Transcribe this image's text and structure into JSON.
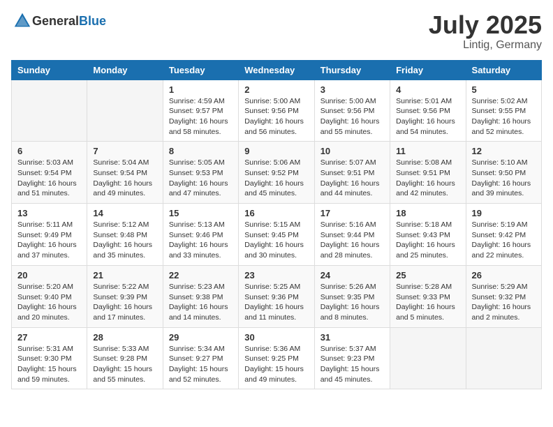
{
  "header": {
    "logo_general": "General",
    "logo_blue": "Blue",
    "month": "July 2025",
    "location": "Lintig, Germany"
  },
  "weekdays": [
    "Sunday",
    "Monday",
    "Tuesday",
    "Wednesday",
    "Thursday",
    "Friday",
    "Saturday"
  ],
  "weeks": [
    [
      {
        "day": "",
        "sunrise": "",
        "sunset": "",
        "daylight": ""
      },
      {
        "day": "",
        "sunrise": "",
        "sunset": "",
        "daylight": ""
      },
      {
        "day": "1",
        "sunrise": "Sunrise: 4:59 AM",
        "sunset": "Sunset: 9:57 PM",
        "daylight": "Daylight: 16 hours and 58 minutes."
      },
      {
        "day": "2",
        "sunrise": "Sunrise: 5:00 AM",
        "sunset": "Sunset: 9:56 PM",
        "daylight": "Daylight: 16 hours and 56 minutes."
      },
      {
        "day": "3",
        "sunrise": "Sunrise: 5:00 AM",
        "sunset": "Sunset: 9:56 PM",
        "daylight": "Daylight: 16 hours and 55 minutes."
      },
      {
        "day": "4",
        "sunrise": "Sunrise: 5:01 AM",
        "sunset": "Sunset: 9:56 PM",
        "daylight": "Daylight: 16 hours and 54 minutes."
      },
      {
        "day": "5",
        "sunrise": "Sunrise: 5:02 AM",
        "sunset": "Sunset: 9:55 PM",
        "daylight": "Daylight: 16 hours and 52 minutes."
      }
    ],
    [
      {
        "day": "6",
        "sunrise": "Sunrise: 5:03 AM",
        "sunset": "Sunset: 9:54 PM",
        "daylight": "Daylight: 16 hours and 51 minutes."
      },
      {
        "day": "7",
        "sunrise": "Sunrise: 5:04 AM",
        "sunset": "Sunset: 9:54 PM",
        "daylight": "Daylight: 16 hours and 49 minutes."
      },
      {
        "day": "8",
        "sunrise": "Sunrise: 5:05 AM",
        "sunset": "Sunset: 9:53 PM",
        "daylight": "Daylight: 16 hours and 47 minutes."
      },
      {
        "day": "9",
        "sunrise": "Sunrise: 5:06 AM",
        "sunset": "Sunset: 9:52 PM",
        "daylight": "Daylight: 16 hours and 45 minutes."
      },
      {
        "day": "10",
        "sunrise": "Sunrise: 5:07 AM",
        "sunset": "Sunset: 9:51 PM",
        "daylight": "Daylight: 16 hours and 44 minutes."
      },
      {
        "day": "11",
        "sunrise": "Sunrise: 5:08 AM",
        "sunset": "Sunset: 9:51 PM",
        "daylight": "Daylight: 16 hours and 42 minutes."
      },
      {
        "day": "12",
        "sunrise": "Sunrise: 5:10 AM",
        "sunset": "Sunset: 9:50 PM",
        "daylight": "Daylight: 16 hours and 39 minutes."
      }
    ],
    [
      {
        "day": "13",
        "sunrise": "Sunrise: 5:11 AM",
        "sunset": "Sunset: 9:49 PM",
        "daylight": "Daylight: 16 hours and 37 minutes."
      },
      {
        "day": "14",
        "sunrise": "Sunrise: 5:12 AM",
        "sunset": "Sunset: 9:48 PM",
        "daylight": "Daylight: 16 hours and 35 minutes."
      },
      {
        "day": "15",
        "sunrise": "Sunrise: 5:13 AM",
        "sunset": "Sunset: 9:46 PM",
        "daylight": "Daylight: 16 hours and 33 minutes."
      },
      {
        "day": "16",
        "sunrise": "Sunrise: 5:15 AM",
        "sunset": "Sunset: 9:45 PM",
        "daylight": "Daylight: 16 hours and 30 minutes."
      },
      {
        "day": "17",
        "sunrise": "Sunrise: 5:16 AM",
        "sunset": "Sunset: 9:44 PM",
        "daylight": "Daylight: 16 hours and 28 minutes."
      },
      {
        "day": "18",
        "sunrise": "Sunrise: 5:18 AM",
        "sunset": "Sunset: 9:43 PM",
        "daylight": "Daylight: 16 hours and 25 minutes."
      },
      {
        "day": "19",
        "sunrise": "Sunrise: 5:19 AM",
        "sunset": "Sunset: 9:42 PM",
        "daylight": "Daylight: 16 hours and 22 minutes."
      }
    ],
    [
      {
        "day": "20",
        "sunrise": "Sunrise: 5:20 AM",
        "sunset": "Sunset: 9:40 PM",
        "daylight": "Daylight: 16 hours and 20 minutes."
      },
      {
        "day": "21",
        "sunrise": "Sunrise: 5:22 AM",
        "sunset": "Sunset: 9:39 PM",
        "daylight": "Daylight: 16 hours and 17 minutes."
      },
      {
        "day": "22",
        "sunrise": "Sunrise: 5:23 AM",
        "sunset": "Sunset: 9:38 PM",
        "daylight": "Daylight: 16 hours and 14 minutes."
      },
      {
        "day": "23",
        "sunrise": "Sunrise: 5:25 AM",
        "sunset": "Sunset: 9:36 PM",
        "daylight": "Daylight: 16 hours and 11 minutes."
      },
      {
        "day": "24",
        "sunrise": "Sunrise: 5:26 AM",
        "sunset": "Sunset: 9:35 PM",
        "daylight": "Daylight: 16 hours and 8 minutes."
      },
      {
        "day": "25",
        "sunrise": "Sunrise: 5:28 AM",
        "sunset": "Sunset: 9:33 PM",
        "daylight": "Daylight: 16 hours and 5 minutes."
      },
      {
        "day": "26",
        "sunrise": "Sunrise: 5:29 AM",
        "sunset": "Sunset: 9:32 PM",
        "daylight": "Daylight: 16 hours and 2 minutes."
      }
    ],
    [
      {
        "day": "27",
        "sunrise": "Sunrise: 5:31 AM",
        "sunset": "Sunset: 9:30 PM",
        "daylight": "Daylight: 15 hours and 59 minutes."
      },
      {
        "day": "28",
        "sunrise": "Sunrise: 5:33 AM",
        "sunset": "Sunset: 9:28 PM",
        "daylight": "Daylight: 15 hours and 55 minutes."
      },
      {
        "day": "29",
        "sunrise": "Sunrise: 5:34 AM",
        "sunset": "Sunset: 9:27 PM",
        "daylight": "Daylight: 15 hours and 52 minutes."
      },
      {
        "day": "30",
        "sunrise": "Sunrise: 5:36 AM",
        "sunset": "Sunset: 9:25 PM",
        "daylight": "Daylight: 15 hours and 49 minutes."
      },
      {
        "day": "31",
        "sunrise": "Sunrise: 5:37 AM",
        "sunset": "Sunset: 9:23 PM",
        "daylight": "Daylight: 15 hours and 45 minutes."
      },
      {
        "day": "",
        "sunrise": "",
        "sunset": "",
        "daylight": ""
      },
      {
        "day": "",
        "sunrise": "",
        "sunset": "",
        "daylight": ""
      }
    ]
  ]
}
